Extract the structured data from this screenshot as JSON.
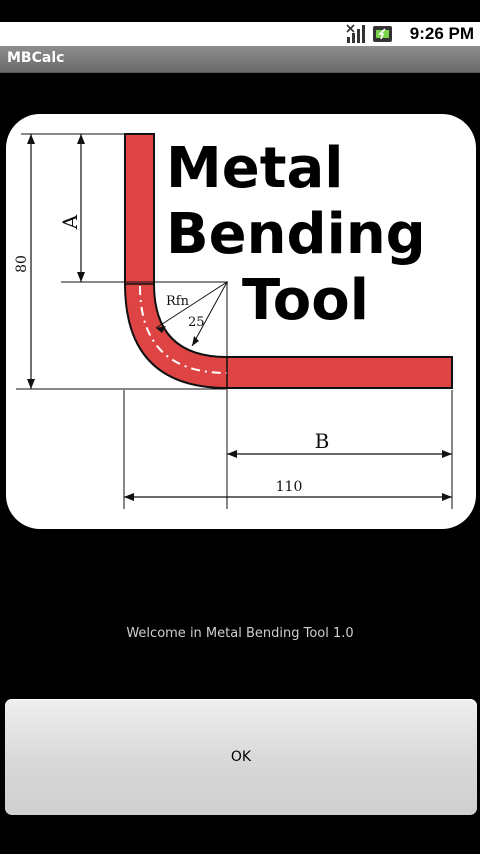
{
  "status_bar": {
    "time": "9:26 PM",
    "icons": [
      "signal-icon",
      "battery-icon"
    ]
  },
  "app": {
    "title": "MBCalc"
  },
  "logo": {
    "title_lines": [
      "Metal",
      "Bending",
      "Tool"
    ],
    "diagram_labels": {
      "a": "A",
      "height": "80",
      "radius": "Rfn",
      "angle": "25",
      "b": "B",
      "width": "110"
    }
  },
  "welcome_text": "Welcome in Metal Bending Tool 1.0",
  "ok_button": {
    "label": "OK"
  },
  "colors": {
    "accent_red": "#de4444",
    "background": "#000000"
  }
}
